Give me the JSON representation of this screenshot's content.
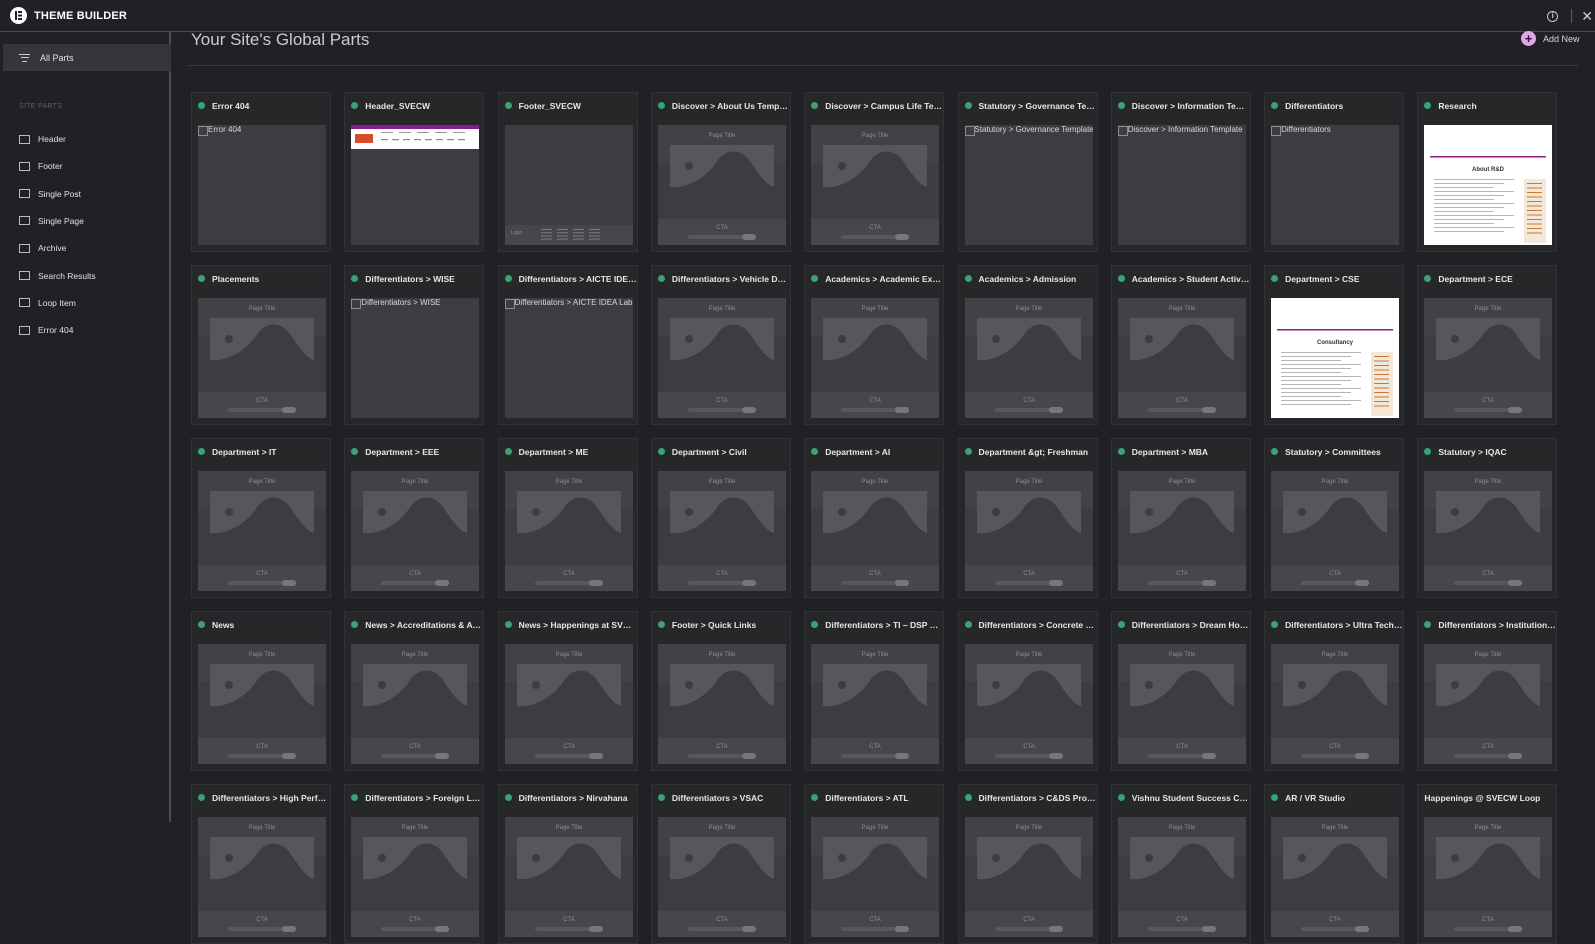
{
  "app": {
    "title": "THEME BUILDER"
  },
  "header": {
    "page_title": "Your Site's Global Parts",
    "add_new_label": "Add New"
  },
  "sidebar": {
    "all_parts_label": "All Parts",
    "section_title": "SITE PARTS",
    "items": [
      {
        "label": "Header",
        "icon": "header-icon"
      },
      {
        "label": "Footer",
        "icon": "footer-icon"
      },
      {
        "label": "Single Post",
        "icon": "single-post-icon"
      },
      {
        "label": "Single Page",
        "icon": "single-page-icon"
      },
      {
        "label": "Archive",
        "icon": "archive-icon"
      },
      {
        "label": "Search Results",
        "icon": "search-results-icon"
      },
      {
        "label": "Loop Item",
        "icon": "loop-item-icon"
      },
      {
        "label": "Error 404",
        "icon": "error-404-icon"
      }
    ]
  },
  "placeholder_texts": {
    "page_title": "Page Title",
    "cta": "CTA",
    "logo": "Logo"
  },
  "status_color": "#3aa374",
  "cards": [
    {
      "title": "Error 404",
      "thumb": "broken",
      "alt": "Error 404"
    },
    {
      "title": "Header_SVECW",
      "thumb": "header"
    },
    {
      "title": "Footer_SVECW",
      "thumb": "footer"
    },
    {
      "title": "Discover > About Us Template",
      "thumb": "page"
    },
    {
      "title": "Discover > Campus Life Templ...",
      "thumb": "page"
    },
    {
      "title": "Statutory > Governance Templ...",
      "thumb": "broken",
      "alt": "Statutory > Governance Template"
    },
    {
      "title": "Discover > Information Templat...",
      "thumb": "broken",
      "alt": "Discover > Information Template"
    },
    {
      "title": "Differentiators",
      "thumb": "broken",
      "alt": "Differentiators"
    },
    {
      "title": "Research",
      "thumb": "doc",
      "doc_title": "About R&D"
    },
    {
      "title": "Placements",
      "thumb": "page"
    },
    {
      "title": "Differentiators > WISE",
      "thumb": "broken",
      "alt": "Differentiators > WISE"
    },
    {
      "title": "Differentiators > AICTE IDEA Lab",
      "thumb": "broken",
      "alt": "Differentiators > AICTE IDEA Lab"
    },
    {
      "title": "Differentiators > Vehicle Design...",
      "thumb": "page"
    },
    {
      "title": "Academics > Academic Excellen...",
      "thumb": "page"
    },
    {
      "title": "Academics > Admission",
      "thumb": "page"
    },
    {
      "title": "Academics > Student Activities...",
      "thumb": "page"
    },
    {
      "title": "Department > CSE",
      "thumb": "doc",
      "doc_title": "Consultancy"
    },
    {
      "title": "Department > ECE",
      "thumb": "page"
    },
    {
      "title": "Department > IT",
      "thumb": "page"
    },
    {
      "title": "Department > EEE",
      "thumb": "page"
    },
    {
      "title": "Department > ME",
      "thumb": "page"
    },
    {
      "title": "Department > Civil",
      "thumb": "page"
    },
    {
      "title": "Department > AI",
      "thumb": "page"
    },
    {
      "title": "Department &gt; Freshman",
      "thumb": "page"
    },
    {
      "title": "Department > MBA",
      "thumb": "page"
    },
    {
      "title": "Statutory > Committees",
      "thumb": "page"
    },
    {
      "title": "Statutory > IQAC",
      "thumb": "page"
    },
    {
      "title": "News",
      "thumb": "page"
    },
    {
      "title": "News > Accreditations & Awards",
      "thumb": "page"
    },
    {
      "title": "News > Happenings at SVECW",
      "thumb": "page"
    },
    {
      "title": "Footer > Quick Links",
      "thumb": "page"
    },
    {
      "title": "Differentiators > TI – DSP Lab",
      "thumb": "page"
    },
    {
      "title": "Differentiators > Concrete Cana...",
      "thumb": "page"
    },
    {
      "title": "Differentiators > Dream House...",
      "thumb": "page"
    },
    {
      "title": "Differentiators > Ultra Tech Ce...",
      "thumb": "page"
    },
    {
      "title": "Differentiators > Institution Inn...",
      "thumb": "page"
    },
    {
      "title": "Differentiators > High Performa...",
      "thumb": "page"
    },
    {
      "title": "Differentiators > Foreign Langu...",
      "thumb": "page"
    },
    {
      "title": "Differentiators > Nirvahana",
      "thumb": "page"
    },
    {
      "title": "Differentiators > VSAC",
      "thumb": "page"
    },
    {
      "title": "Differentiators > ATL",
      "thumb": "page"
    },
    {
      "title": "Differentiators > C&DS Progra...",
      "thumb": "page"
    },
    {
      "title": "Vishnu Student Success Center...",
      "thumb": "page"
    },
    {
      "title": "AR / VR Studio",
      "thumb": "page"
    },
    {
      "title": "Happenings @ SVECW Loop",
      "thumb": "page",
      "no_status": true
    }
  ]
}
